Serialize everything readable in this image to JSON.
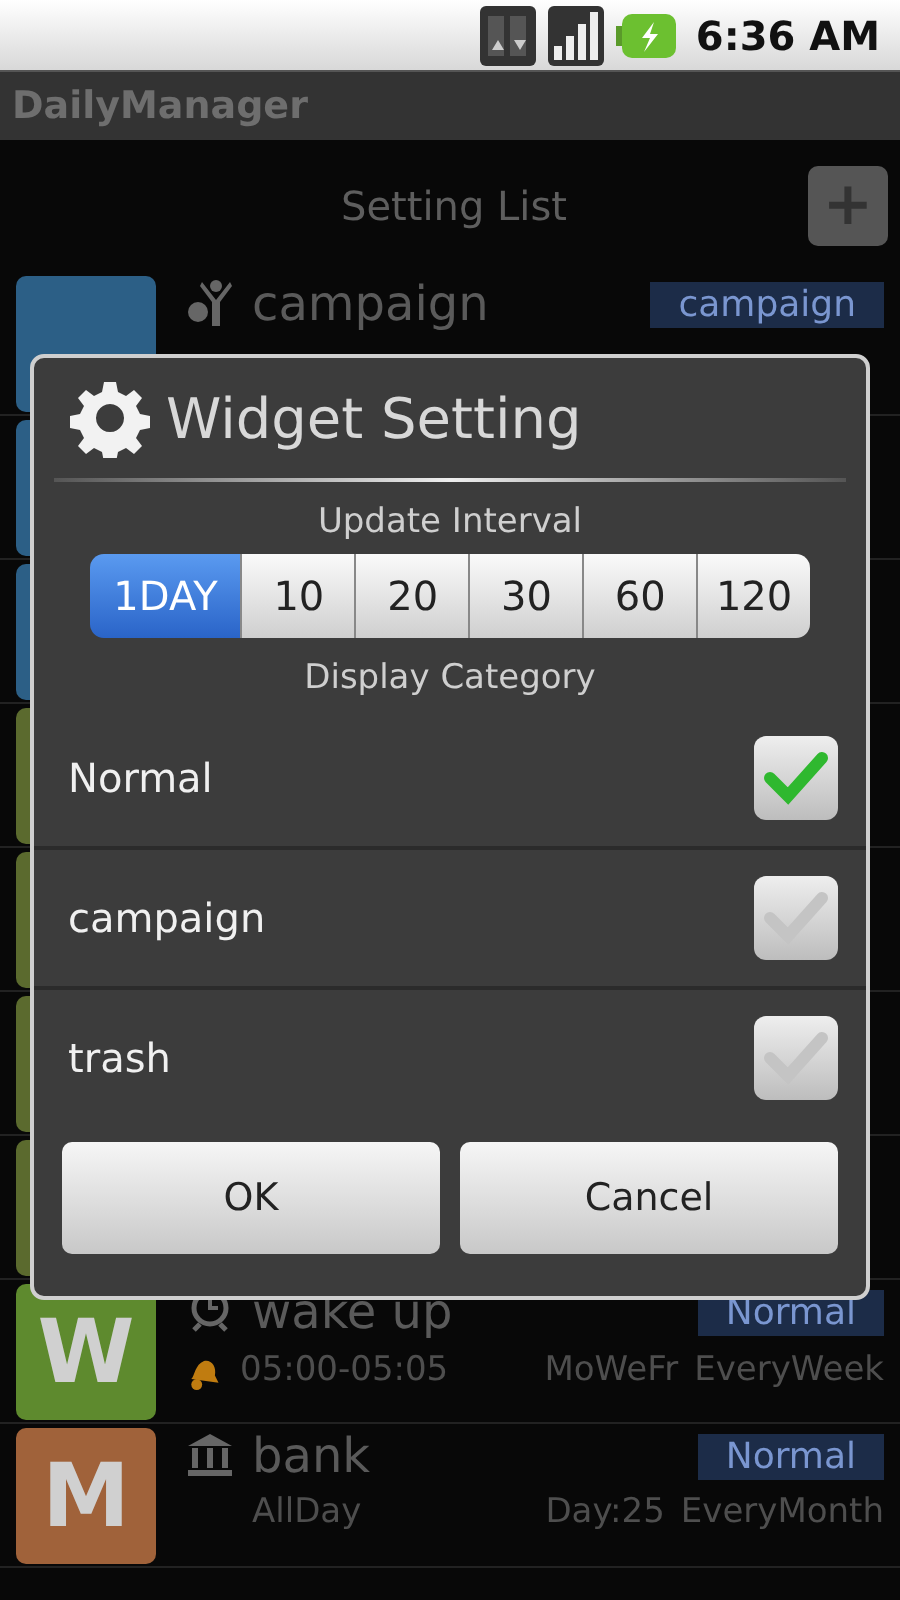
{
  "status_bar": {
    "time": "6:36 AM"
  },
  "app_bar": {
    "title": "DailyManager"
  },
  "list_header": {
    "title": "Setting List",
    "add_label": "+"
  },
  "rows": [
    {
      "kind": "campaign",
      "color": "#2c5f86",
      "title": "campaign",
      "badge": "campaign"
    },
    {
      "kind": "hidden",
      "color": "#2c5f86"
    },
    {
      "kind": "hidden",
      "color": "#2c5f86"
    },
    {
      "kind": "hidden",
      "color": "#5b6a2e"
    },
    {
      "kind": "hidden",
      "color": "#5b6a2e"
    },
    {
      "kind": "hidden",
      "color": "#5b6a2e"
    },
    {
      "kind": "hidden",
      "color": "#5b6a2e"
    },
    {
      "kind": "alarm",
      "letter": "W",
      "color": "#5e8a2e",
      "title": "wake up",
      "badge": "Normal",
      "time": "05:00-05:05",
      "days": "MoWeFr",
      "repeat": "EveryWeek"
    },
    {
      "kind": "bank",
      "letter": "M",
      "color": "#a0623a",
      "title": "bank",
      "badge": "Normal",
      "time": "AllDay",
      "days": "Day:25",
      "repeat": "EveryMonth"
    }
  ],
  "dialog": {
    "title": "Widget Setting",
    "interval_label": "Update Interval",
    "intervals": [
      {
        "label": "1DAY",
        "selected": true
      },
      {
        "label": "10",
        "selected": false
      },
      {
        "label": "20",
        "selected": false
      },
      {
        "label": "30",
        "selected": false
      },
      {
        "label": "60",
        "selected": false
      },
      {
        "label": "120",
        "selected": false
      }
    ],
    "category_label": "Display Category",
    "categories": [
      {
        "label": "Normal",
        "checked": true
      },
      {
        "label": "campaign",
        "checked": false
      },
      {
        "label": "trash",
        "checked": false
      }
    ],
    "buttons": [
      "OK",
      "Cancel"
    ]
  }
}
